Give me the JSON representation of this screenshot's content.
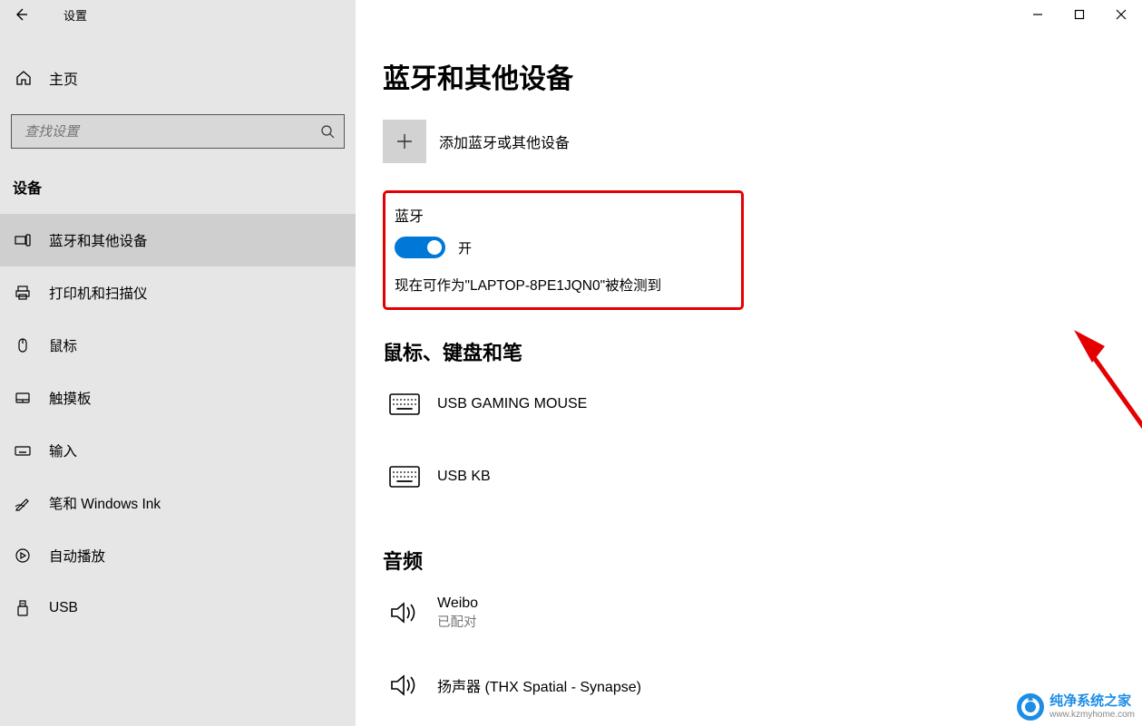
{
  "titlebar": {
    "title": "设置"
  },
  "sidebar": {
    "home_label": "主页",
    "search_placeholder": "查找设置",
    "category": "设备",
    "items": [
      {
        "label": "蓝牙和其他设备"
      },
      {
        "label": "打印机和扫描仪"
      },
      {
        "label": "鼠标"
      },
      {
        "label": "触摸板"
      },
      {
        "label": "输入"
      },
      {
        "label": "笔和 Windows Ink"
      },
      {
        "label": "自动播放"
      },
      {
        "label": "USB"
      }
    ]
  },
  "content": {
    "page_title": "蓝牙和其他设备",
    "add_device_label": "添加蓝牙或其他设备",
    "bluetooth": {
      "section_title": "蓝牙",
      "toggle_label": "开",
      "discover_text": "现在可作为\"LAPTOP-8PE1JQN0\"被检测到"
    },
    "peripherals": {
      "header": "鼠标、键盘和笔",
      "items": [
        {
          "name": "USB GAMING MOUSE"
        },
        {
          "name": "USB KB"
        }
      ]
    },
    "audio": {
      "header": "音频",
      "items": [
        {
          "name": "Weibo",
          "status": "已配对"
        },
        {
          "name": "扬声器 (THX Spatial - Synapse)"
        }
      ]
    }
  },
  "watermark": {
    "text": "纯净系统之家",
    "url": "www.kzmyhome.com"
  }
}
